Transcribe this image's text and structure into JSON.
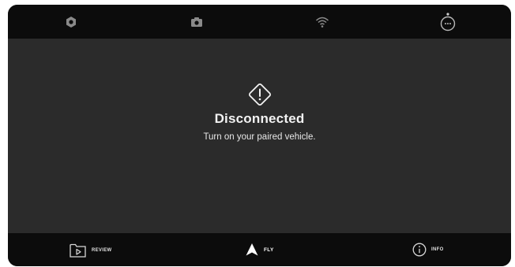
{
  "topbar": {
    "icons": [
      "hexagon-settings-icon",
      "camera-icon",
      "wifi-icon",
      "vehicle-status-icon"
    ]
  },
  "status": {
    "icon": "warning-diamond-icon",
    "title": "Disconnected",
    "message": "Turn on your paired vehicle."
  },
  "bottom_nav": {
    "review_label": "REVIEW",
    "fly_label": "FLY",
    "info_label": "INFO",
    "active": "FLY"
  },
  "colors": {
    "bar_background": "#0c0c0c",
    "main_background": "#2b2b2b",
    "text": "#f2f2f2"
  }
}
